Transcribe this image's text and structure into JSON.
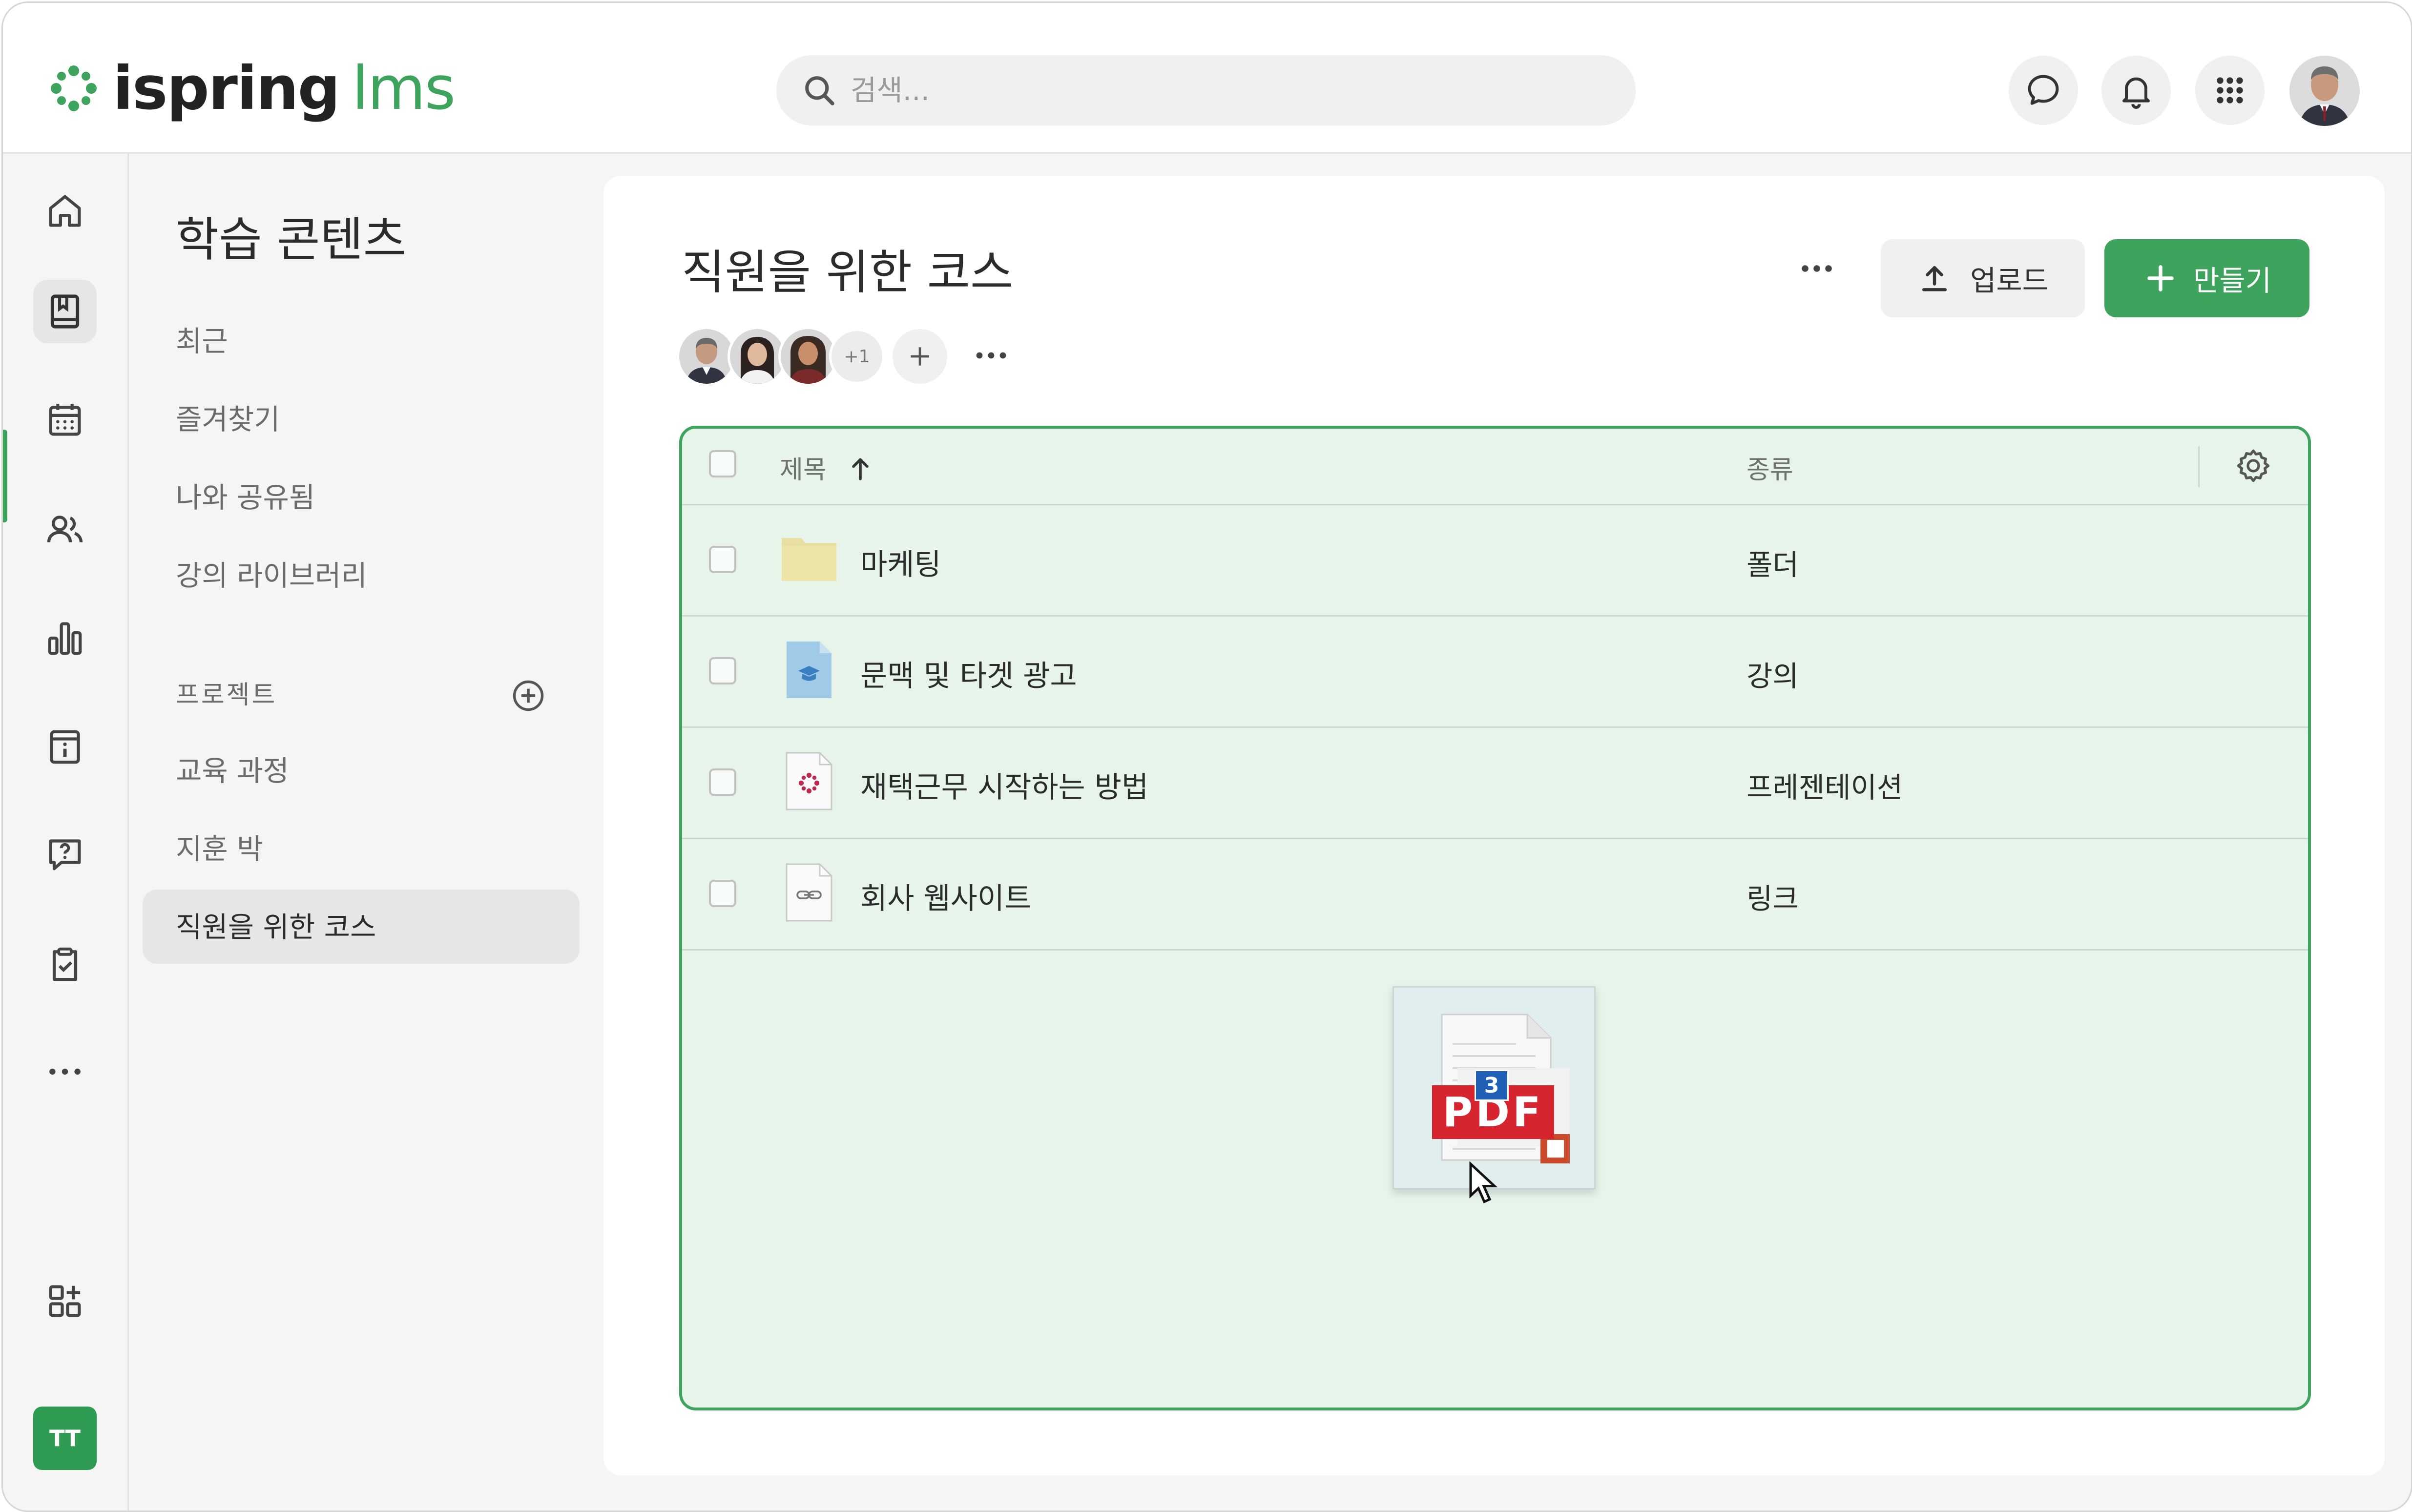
{
  "app": {
    "logo_main": "ispring",
    "logo_sub": "lms",
    "accent": "#3da35d"
  },
  "header": {
    "search_placeholder": "검색...",
    "icons": [
      "chat-icon",
      "bell-icon",
      "apps-grid-icon"
    ]
  },
  "rail": {
    "items": [
      "home-icon",
      "book-icon",
      "calendar-icon",
      "users-icon",
      "bar-chart-icon",
      "info-icon",
      "question-icon",
      "clipboard-check-icon",
      "more-icon",
      "add-widget-icon"
    ],
    "active": "book-icon",
    "user_initials": "TT"
  },
  "sidebar": {
    "title": "학습 콘텐츠",
    "items": [
      "최근",
      "즐겨찾기",
      "나와 공유됨",
      "강의 라이브러리"
    ],
    "projects_label": "프로젝트",
    "projects": [
      "교육 과정",
      "지훈 박",
      "직원을 위한 코스"
    ],
    "active_project": "직원을 위한 코스"
  },
  "main": {
    "title": "직원을 위한 코스",
    "members_extra": "+1",
    "upload_label": "업로드",
    "create_label": "만들기",
    "table": {
      "col_title": "제목",
      "col_type": "종류",
      "rows": [
        {
          "title": "마케팅",
          "type": "폴더",
          "icon": "folder-icon"
        },
        {
          "title": "문맥 및 타겟 광고",
          "type": "강의",
          "icon": "course-file-icon"
        },
        {
          "title": "재택근무 시작하는 방법",
          "type": "프레젠테이션",
          "icon": "presentation-file-icon"
        },
        {
          "title": "회사 웹사이트",
          "type": "링크",
          "icon": "link-file-icon"
        }
      ]
    },
    "drag": {
      "count": "3",
      "label": "PDF"
    }
  }
}
